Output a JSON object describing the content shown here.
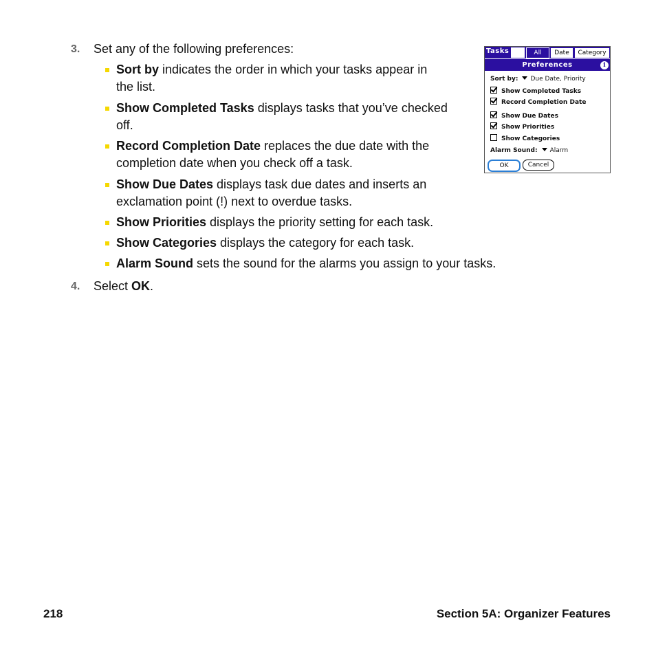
{
  "steps": [
    {
      "number": "3.",
      "text": "Set any of the following preferences:"
    },
    {
      "number": "4.",
      "text_prefix": "Select ",
      "text_bold": "OK",
      "text_suffix": "."
    }
  ],
  "bullets": [
    {
      "term": "Sort by",
      "line1": " indicates the order in which your tasks appear in",
      "line2": "the list."
    },
    {
      "term": "Show Completed Tasks",
      "line1": " displays tasks that you’ve checked",
      "line2": "off."
    },
    {
      "term": "Record Completion Date",
      "line1": " replaces the due date with the",
      "line2": "completion date when you check off a task."
    },
    {
      "term": "Show Due Dates",
      "line1": " displays task due dates and inserts an",
      "line2": "exclamation point (!) next to overdue tasks."
    },
    {
      "term": "Show Priorities",
      "line1": " displays the priority setting for each task.",
      "line2": ""
    },
    {
      "term": "Show Categories",
      "line1": " displays the category for each task.",
      "line2": ""
    },
    {
      "term": "Alarm Sound",
      "line1": " sets the sound for the alarms you assign to your tasks.",
      "line2": ""
    }
  ],
  "screenshot": {
    "app_title": "Tasks",
    "tabs": [
      {
        "label": "All",
        "selected": true
      },
      {
        "label": "Date",
        "selected": false
      },
      {
        "label": "Category",
        "selected": false
      }
    ],
    "dialog_title": "Preferences",
    "info_icon": "i",
    "sort_by_label": "Sort by:",
    "sort_by_value": "Due Date, Priority",
    "checkboxes": [
      {
        "label": "Show Completed Tasks",
        "checked": true
      },
      {
        "label": "Record Completion Date",
        "checked": true
      },
      {
        "label": "Show Due Dates",
        "checked": true
      },
      {
        "label": "Show Priorities",
        "checked": true
      },
      {
        "label": "Show Categories",
        "checked": false
      }
    ],
    "alarm_sound_label": "Alarm Sound:",
    "alarm_sound_value": "Alarm",
    "ok_label": "OK",
    "cancel_label": "Cancel",
    "accent_color": "#2b0fa0"
  },
  "footer": {
    "page_number": "218",
    "section_title": "Section 5A: Organizer Features"
  },
  "colors": {
    "bullet": "#f5d800",
    "step_number": "#666666"
  }
}
